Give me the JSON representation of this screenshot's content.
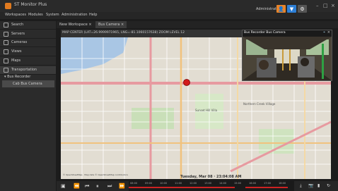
{
  "app": {
    "title": "ST Monitor Plus",
    "user": "Administrator"
  },
  "menu": [
    "Workspaces",
    "Modules",
    "System",
    "Administration",
    "Help"
  ],
  "sidebar": {
    "items": [
      {
        "label": "Search",
        "icon": "search-icon"
      },
      {
        "label": "Servers",
        "icon": "server-icon"
      },
      {
        "label": "Cameras",
        "icon": "camera-icon"
      },
      {
        "label": "Views",
        "icon": "views-icon"
      },
      {
        "label": "Maps",
        "icon": "map-icon"
      },
      {
        "label": "Transportation",
        "icon": "bus-icon"
      }
    ],
    "tree": [
      {
        "label": "Bus Recorder"
      },
      {
        "label": "Cab Bus Camera"
      }
    ]
  },
  "tabs": [
    {
      "label": "New Workspace",
      "close": "×"
    },
    {
      "label": "Bus Camera",
      "close": "×"
    }
  ],
  "map": {
    "header": "MAP CENTER (LAT=26.9999971965, LNG=-81.1060157638) ZOOM LEVEL 12",
    "labels": [
      "Sunset Hill Villa",
      "Northern Creek Village"
    ],
    "attribution": "© OpenStreetMap  · Map data © OpenStreetMap contributors"
  },
  "video": {
    "title": "Bus Recorder Bus Camera"
  },
  "timeline": {
    "overlay_date": "Tuesday, Mar 08 · 23:04:08 AM",
    "ticks": [
      "08:00",
      "09:00",
      "10:00",
      "11:00",
      "12:00",
      "13:00",
      "14:00",
      "15:00",
      "16:00",
      "17:00",
      "18:00"
    ]
  },
  "colors": {
    "accent_orange": "#e8842a",
    "accent_blue": "#2d7fd6",
    "marker_red": "#d11a1a",
    "timeline_red": "#cc2222"
  }
}
